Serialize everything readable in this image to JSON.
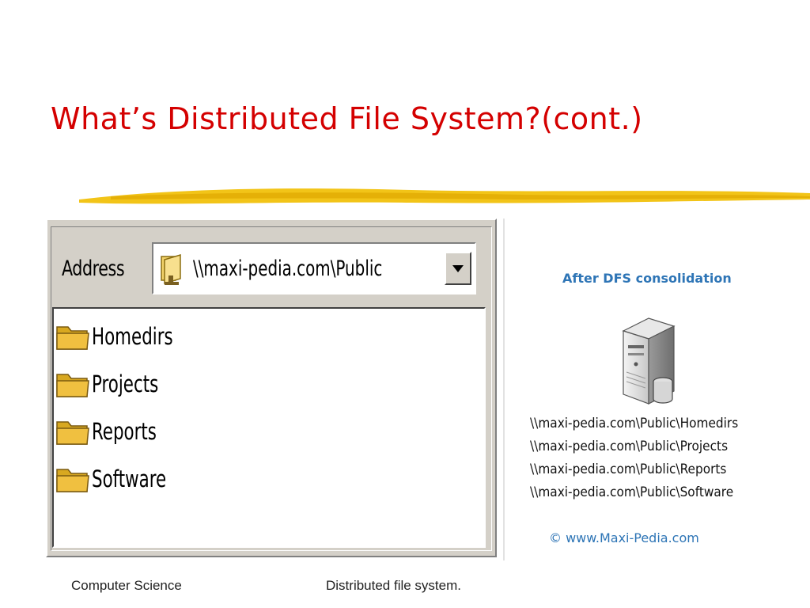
{
  "slide": {
    "title": "What’s Distributed File System?(cont.)"
  },
  "explorer": {
    "address_label": "Address",
    "address_value": "\\\\maxi-pedia.com\\Public",
    "folders": [
      "Homedirs",
      "Projects",
      "Reports",
      "Software"
    ]
  },
  "dfs_image": {
    "heading": "After DFS consolidation",
    "paths": [
      "\\\\maxi-pedia.com\\Public\\Homedirs",
      "\\\\maxi-pedia.com\\Public\\Projects",
      "\\\\maxi-pedia.com\\Public\\Reports",
      "\\\\maxi-pedia.com\\Public\\Software"
    ],
    "copyright": "© www.Maxi-Pedia.com"
  },
  "footer": {
    "left": "Computer Science",
    "center": "Distributed file system."
  },
  "colors": {
    "title": "#d40000",
    "accent_stroke": "#f2c418",
    "link_blue": "#2e75b6",
    "folder": "#f0c040"
  },
  "icons": {
    "address": "network-folder-icon",
    "dropdown": "triangle-down-icon",
    "folder": "folder-icon",
    "server": "server-icon"
  }
}
